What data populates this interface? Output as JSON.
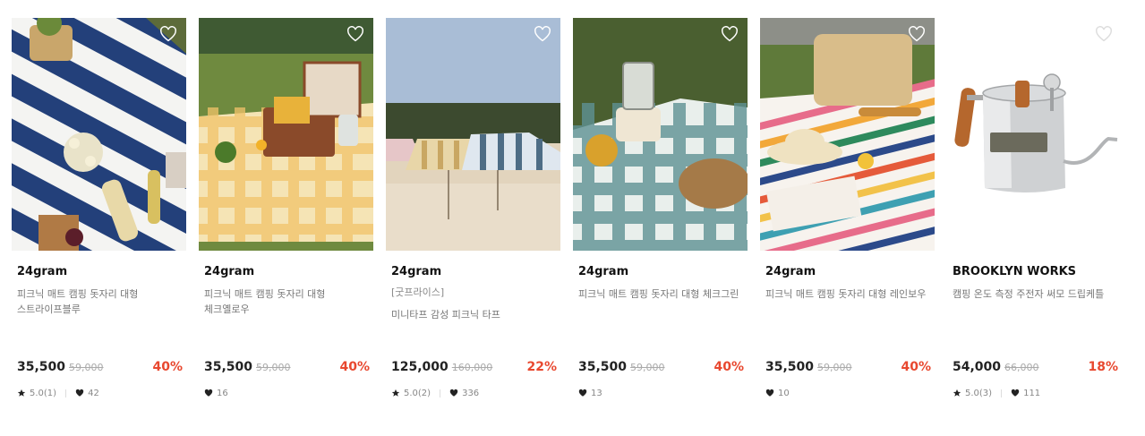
{
  "products": [
    {
      "brand": "24gram",
      "tag": "",
      "title": "피크닉 매트 캠핑 돗자리 대형 스트라이프블루",
      "price": "35,500",
      "original_price": "59,000",
      "discount": "40%",
      "rating": "5.0(1)",
      "likes": "42",
      "heart_color": "#ffffff"
    },
    {
      "brand": "24gram",
      "tag": "",
      "title": "피크닉 매트 캠핑 돗자리 대형 체크옐로우",
      "price": "35,500",
      "original_price": "59,000",
      "discount": "40%",
      "rating": "",
      "likes": "16",
      "heart_color": "#ffffff"
    },
    {
      "brand": "24gram",
      "tag": "[굿프라이스]",
      "title": "미니타프 감성 피크닉 타프",
      "price": "125,000",
      "original_price": "160,000",
      "discount": "22%",
      "rating": "5.0(2)",
      "likes": "336",
      "heart_color": "#ffffff"
    },
    {
      "brand": "24gram",
      "tag": "",
      "title": "피크닉 매트 캠핑 돗자리 대형 체크그린",
      "price": "35,500",
      "original_price": "59,000",
      "discount": "40%",
      "rating": "",
      "likes": "13",
      "heart_color": "#ffffff"
    },
    {
      "brand": "24gram",
      "tag": "",
      "title": "피크닉 매트 캠핑 돗자리 대형 레인보우",
      "price": "35,500",
      "original_price": "59,000",
      "discount": "40%",
      "rating": "",
      "likes": "10",
      "heart_color": "#ffffff"
    },
    {
      "brand": "BROOKLYN WORKS",
      "tag": "",
      "title": "캠핑 온도 측정 주전자 써모 드립케틀",
      "price": "54,000",
      "original_price": "66,000",
      "discount": "18%",
      "rating": "5.0(3)",
      "likes": "111",
      "heart_color": "#dddddd"
    }
  ],
  "colors": {
    "discount": "#e8482f",
    "price": "#222222",
    "muted": "#888888"
  }
}
